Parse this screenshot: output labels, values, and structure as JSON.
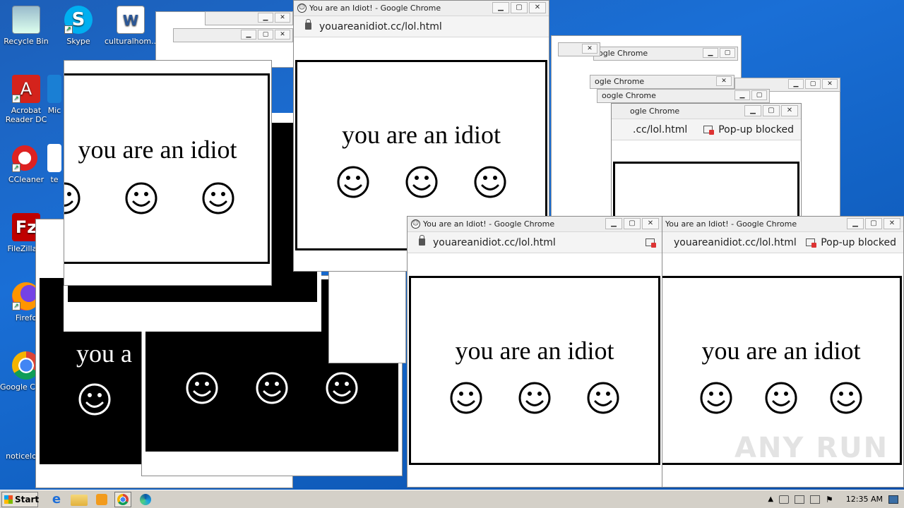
{
  "desktop": {
    "icons": [
      {
        "label": "Recycle Bin",
        "icon": "recycle-bin-icon"
      },
      {
        "label": "Skype",
        "icon": "skype-icon"
      },
      {
        "label": "culturalhom...",
        "icon": "word-document-icon"
      },
      {
        "label": "Acrobat Reader DC",
        "icon": "acrobat-icon"
      },
      {
        "label": "Mic",
        "icon": "microsoft-edge-icon"
      },
      {
        "label": "CCleaner",
        "icon": "ccleaner-icon"
      },
      {
        "label": "te",
        "icon": "text-file-icon"
      },
      {
        "label": "FileZilla C",
        "icon": "filezilla-icon"
      },
      {
        "label": "Firefo",
        "icon": "firefox-icon"
      },
      {
        "label": "Google Chrom",
        "icon": "chrome-icon"
      },
      {
        "label": "noticelong",
        "icon": "file-icon"
      }
    ]
  },
  "popup": {
    "window_title": "You are an Idiot! - Google Chrome",
    "url": "youareanidiot.cc/lol.html",
    "url_partial": ".cc/lol.html",
    "popup_blocked": "Pop-up blocked",
    "message": "you are an idiot",
    "message_partial": "you are an idiot",
    "message_cut": "you a",
    "title_partial": "ogle Chrome",
    "title_partial2": "oogle Chrome",
    "controls": {
      "minimize": "▁",
      "maximize": "▢",
      "close": "✕"
    }
  },
  "taskbar": {
    "start_label": "Start",
    "clock": "12:35 AM"
  },
  "watermark": "ANY RUN"
}
